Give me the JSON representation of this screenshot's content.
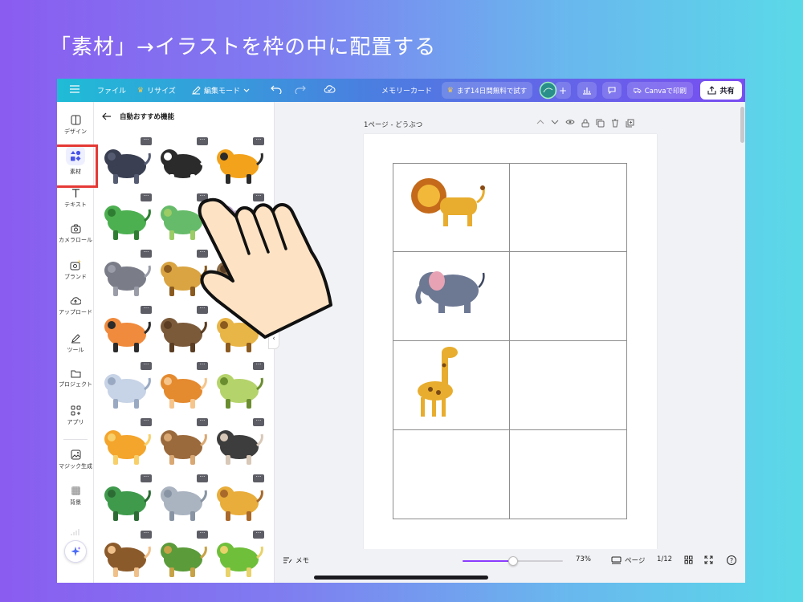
{
  "slide": {
    "title": "「素材」→イラストを枠の中に配置する"
  },
  "topbar": {
    "menu_icon": "hamburger-icon",
    "file_label": "ファイル",
    "resize_label": "リサイズ",
    "edit_mode_label": "編集モード",
    "doc_title": "メモリーカード",
    "trial_label": "まず14日間無料で試す",
    "print_label": "Canvaで印刷",
    "share_label": "共有",
    "accent": "#8b3dff"
  },
  "rail": {
    "items": [
      {
        "label": "デザイン",
        "icon": "layout-icon"
      },
      {
        "label": "素材",
        "icon": "elements-icon"
      },
      {
        "label": "テキスト",
        "icon": "text-icon"
      },
      {
        "label": "カメラロール",
        "icon": "camera-icon"
      },
      {
        "label": "ブランド",
        "icon": "brand-icon"
      },
      {
        "label": "アップロード",
        "icon": "upload-icon"
      },
      {
        "label": "ツール",
        "icon": "pen-icon"
      },
      {
        "label": "プロジェクト",
        "icon": "folder-icon"
      },
      {
        "label": "アプリ",
        "icon": "apps-icon"
      },
      {
        "label": "マジック生成",
        "icon": "magic-image-icon"
      },
      {
        "label": "背景",
        "icon": "background-icon"
      }
    ]
  },
  "panel": {
    "title": "自動おすすめ機能",
    "more_glyph": "···",
    "collapse_glyph": "‹",
    "thumbnails": [
      "gorilla",
      "zebra",
      "tiger",
      "crocodile",
      "crocodile-pair",
      "hippo",
      "elephant",
      "lion",
      "bear",
      "tiger-leaping",
      "bear-brown",
      "giraffe",
      "elephant-light",
      "monkey",
      "snake",
      "lion-cub",
      "monkey-standing",
      "ostrich",
      "crocodile-green",
      "elephant-grey",
      "giraffe-small",
      "monkey-face",
      "turtle",
      "snake-green"
    ]
  },
  "canvas": {
    "page_label": "1ページ - どうぶつ",
    "cells": [
      "lion",
      "",
      "elephant",
      "",
      "giraffe",
      "",
      "",
      ""
    ]
  },
  "bottombar": {
    "notes_label": "メモ",
    "zoom_value": "73%",
    "zoom_fraction": 0.5,
    "pages_label": "ページ",
    "page_count": "1/12",
    "help_glyph": "?"
  }
}
